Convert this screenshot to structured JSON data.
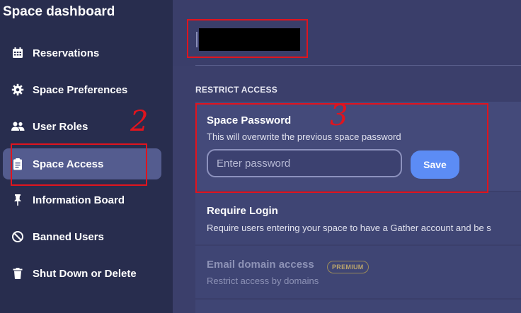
{
  "sidebar": {
    "title": "Space dashboard",
    "items": [
      {
        "label": "Reservations",
        "icon": "calendar-icon"
      },
      {
        "label": "Space Preferences",
        "icon": "gear-icon"
      },
      {
        "label": "User Roles",
        "icon": "users-icon"
      },
      {
        "label": "Space Access",
        "icon": "clipboard-icon",
        "active": true
      },
      {
        "label": "Information Board",
        "icon": "pin-icon"
      },
      {
        "label": "Banned Users",
        "icon": "ban-icon"
      },
      {
        "label": "Shut Down or Delete",
        "icon": "trash-icon"
      }
    ]
  },
  "main": {
    "section_heading": "RESTRICT ACCESS",
    "space_password": {
      "title": "Space Password",
      "description": "This will overwrite the previous space password",
      "placeholder": "Enter password",
      "value": "",
      "save_label": "Save"
    },
    "require_login": {
      "title": "Require Login",
      "description": "Require users entering your space to have a Gather account and be s"
    },
    "email_domain": {
      "title": "Email domain access",
      "badge": "PREMIUM",
      "description": "Restrict access by domains"
    }
  },
  "annotations": [
    "2",
    "3"
  ],
  "colors": {
    "sidebar_bg": "#282d4e",
    "main_bg": "#3b3f6b",
    "active_item": "#545c8f",
    "save_button": "#5c8cf5",
    "annotation": "#e0141e"
  }
}
